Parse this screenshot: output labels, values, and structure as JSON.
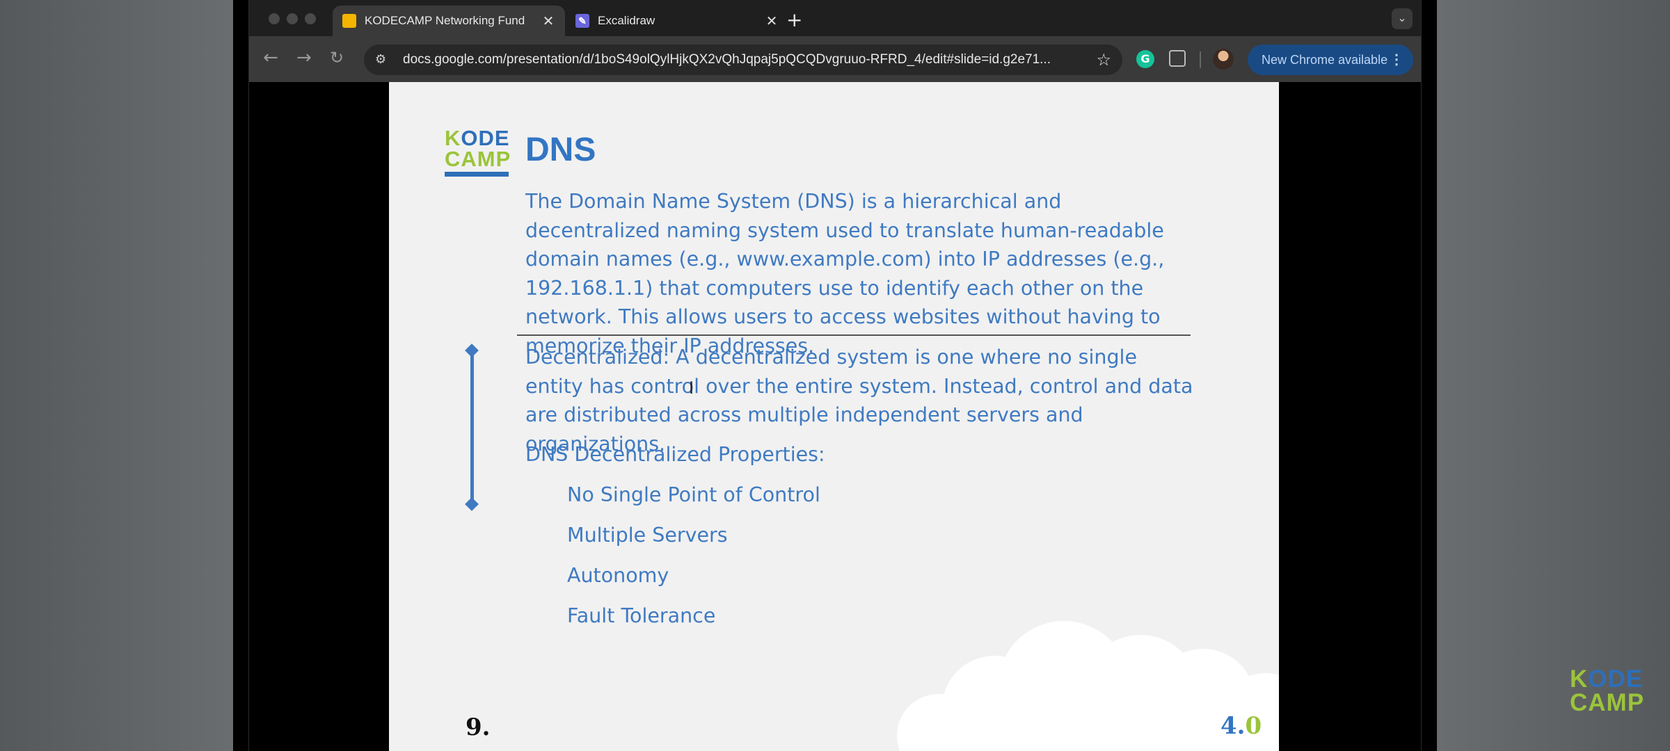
{
  "browser": {
    "tabs": [
      {
        "title": "KODECAMP Networking Fund",
        "active": true
      },
      {
        "title": "Excalidraw",
        "active": false
      }
    ],
    "new_tab": "+",
    "url": "docs.google.com/presentation/d/1boS49olQylHjkQX2vQhJqpaj5pQCQDvgruuo-RFRD_4/edit#slide=id.g2e71...",
    "update_button": "New Chrome available",
    "grammarly_letter": "G"
  },
  "slide": {
    "logo_line1_k": "K",
    "logo_line1_rest": "ODE",
    "logo_line2": "CAMP",
    "title": "DNS",
    "paragraph1": "The Domain Name System (DNS) is a hierarchical and decentralized naming system used to translate human-readable domain names (e.g., www.example.com) into IP addresses (e.g., 192.168.1.1) that computers use to identify each other on the network. This allows users to access websites without having to memorize their IP addresses.",
    "paragraph2": "Decentralized: A decentralized system is one where no single entity has control over the entire system. Instead, control and data are distributed across multiple independent servers and organizations.",
    "properties_heading": "DNS Decentralized Properties:",
    "properties": [
      "No Single Point of Control",
      "Multiple Servers",
      "Autonomy",
      "Fault Tolerance"
    ],
    "page_number": "9.",
    "version_major": "4.",
    "version_minor": "0"
  },
  "watermark": {
    "line1_k": "K",
    "line1_rest": "ODE",
    "line2": "CAMP"
  },
  "colors": {
    "accent_blue": "#3375c3",
    "accent_green": "#9bc43a",
    "update_button_bg": "#1a4a83"
  }
}
